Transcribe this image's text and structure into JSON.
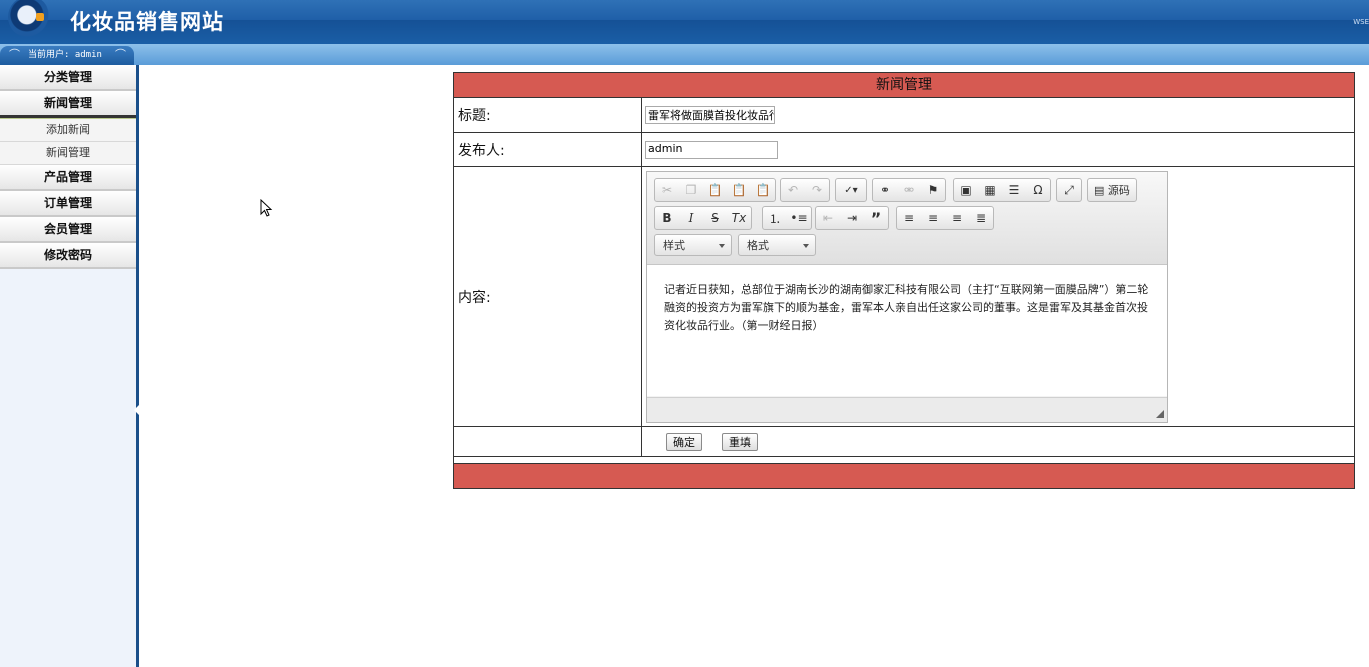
{
  "header": {
    "site_title": "化妆品销售网站",
    "right_text": "WSE"
  },
  "userbar": {
    "label": "当前用户: admin"
  },
  "sidebar": {
    "menus": [
      {
        "label": "分类管理"
      },
      {
        "label": "新闻管理",
        "subitems": [
          "添加新闻",
          "新闻管理"
        ]
      },
      {
        "label": "产品管理"
      },
      {
        "label": "订单管理"
      },
      {
        "label": "会员管理"
      },
      {
        "label": "修改密码"
      }
    ]
  },
  "form": {
    "title": "新闻管理",
    "title_label": "标题:",
    "title_value": "雷军将做面膜首投化妆品行",
    "author_label": "发布人:",
    "author_value": "admin",
    "content_label": "内容:",
    "content_text": "记者近日获知，总部位于湖南长沙的湖南御家汇科技有限公司（主打“互联网第一面膜品牌”）第二轮融资的投资方为雷军旗下的顺为基金，雷军本人亲自出任这家公司的董事。这是雷军及其基金首次投资化妆品行业。（第一财经日报）",
    "submit_label": "确定",
    "reset_label": "重填"
  },
  "editor": {
    "source_label": "源码",
    "style_combo": "样式",
    "format_combo": "格式"
  },
  "colors": {
    "accent": "#d65a52",
    "header": "#1f5fa8",
    "sidebar_border": "#1a4f8a"
  }
}
